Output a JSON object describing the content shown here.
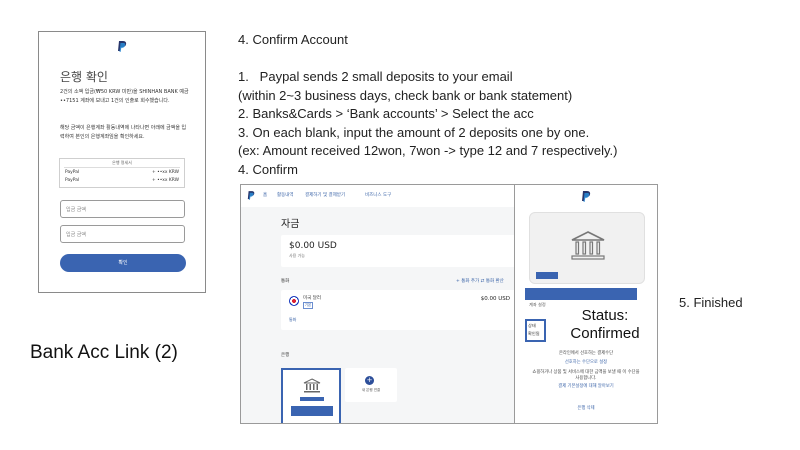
{
  "phone": {
    "title": "은행 확인",
    "para1": "2건의 소액 입금(₩50 KRW 미만)을 SHINHAN BANK 예금 ••7151 계좌에 보내고 1건의 인출로 회수했습니다.",
    "para2": "해당 금액이 은행계좌 활동내역에 나타나면 아래에 금액을 입력하여 본인의 은행계좌임을 확인하세요.",
    "statement_header": "은행 명세서",
    "statement_rows": [
      {
        "name": "PayPal",
        "value": "+ ••xx KRW"
      },
      {
        "name": "PayPal",
        "value": "+ ••xx KRW"
      }
    ],
    "field1_placeholder": "입금 금액",
    "field2_placeholder": "입금 금액",
    "confirm_button": "확인"
  },
  "section_title": "Bank Acc Link (2)",
  "instructions": {
    "heading": "4. Confirm Account",
    "steps": [
      "1.   Paypal sends 2 small deposits to your email",
      "(within 2~3 business days, check bank or bank statement)",
      "2. Banks&Cards > ‘Bank accounts’ > Select the acc",
      "3. On each blank, input the amount of 2 deposits one by one.",
      "(ex: Amount received 12won, 7won -> type 12 and 7 respectively.)",
      "4. Confirm"
    ]
  },
  "web": {
    "nav": [
      "홈",
      "활동내역",
      "결제하기 및 결제받기",
      "비즈니스 도구"
    ],
    "funds_title": "자금",
    "balance": "$0.00 USD",
    "balance_sub": "사용 가능",
    "currency_header": "통화",
    "currency_links": "+ 통화 추가   ⇄ 통화 환산",
    "currency_name": "미국 달러",
    "currency_tag": "기본",
    "currency_amount": "$0.00 USD",
    "currency_more": "통화",
    "bank_header": "은행",
    "add_bank": "새 은행 연결"
  },
  "panel": {
    "bank_settings": "계좌 설정",
    "status_line1": "상태",
    "status_line2": "확인됨",
    "preferred_q": "온라인에서 선호하는 결제수단",
    "preferred_link": "선호하는 수단으로 설정",
    "desc": "쇼핑하거나 상품 및 서비스에 대한 금액을 보낼 때 이 수단을 사용합니다.",
    "learn_more": "결제 기본설정에 대해 알아보기",
    "remove_bank": "은행 삭제"
  },
  "status_label": "Status:",
  "status_value": "Confirmed",
  "finished_label": "5. Finished",
  "colors": {
    "paypal_blue": "#3a64b1",
    "link_blue": "#3b64a8"
  },
  "icons": [
    "paypal-logo-icon",
    "bank-icon",
    "us-flag-icon",
    "plus-icon"
  ]
}
